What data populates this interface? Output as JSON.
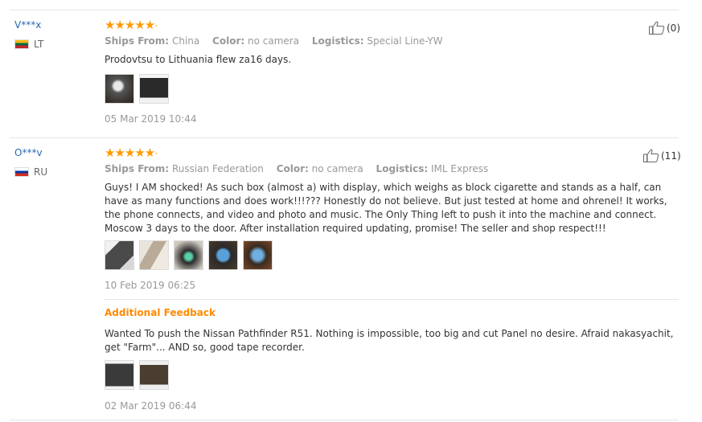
{
  "reviews": [
    {
      "user": "V***x",
      "country": "LT",
      "stars": "★★★★★",
      "ships_label": "Ships From:",
      "ships_value": "China",
      "color_label": "Color:",
      "color_value": "no camera",
      "logistics_label": "Logistics:",
      "logistics_value": "Special Line-YW",
      "text": "Prodovtsu to Lithuania flew za16 days.",
      "date": "05 Mar 2019 10:44",
      "helpful_count": "(0)"
    },
    {
      "user": "O***v",
      "country": "RU",
      "stars": "★★★★★",
      "ships_label": "Ships From:",
      "ships_value": "Russian Federation",
      "color_label": "Color:",
      "color_value": "no camera",
      "logistics_label": "Logistics:",
      "logistics_value": "IML Express",
      "text": "Guys! I AM shocked! As such box (almost a) with display, which weighs as block cigarette and stands as a half, can have as many functions and does work!!!??? Honestly do not believe. But just tested at home and ohrenel! It works, the phone connects, and video and photo and music. The Only Thing left to push it into the machine and connect. Moscow 3 days to the door. After installation required updating, promise! The seller and shop respect!!!",
      "date": "10 Feb 2019 06:25",
      "helpful_count": "(11)",
      "additional": {
        "label": "Additional Feedback",
        "text": "Wanted To push the Nissan Pathfinder R51. Nothing is impossible, too big and cut Panel no desire. Afraid nakasyachit, get \"Farm\"... AND so, good tape recorder.",
        "date": "02 Mar 2019 06:44"
      }
    }
  ]
}
